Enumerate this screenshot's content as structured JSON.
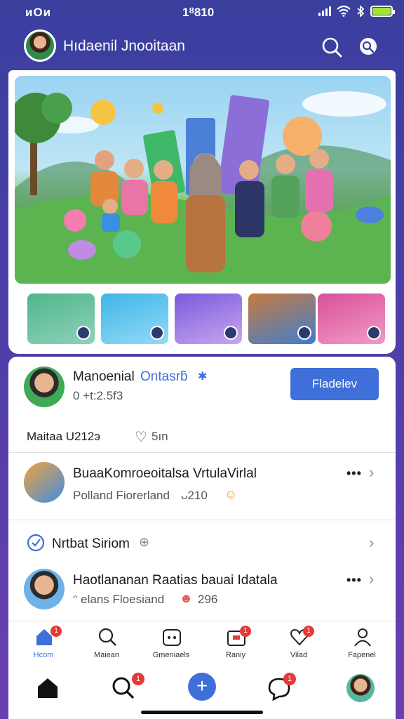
{
  "status": {
    "carrier": "ᴎOᴎ",
    "time": "1ᴽ810"
  },
  "header": {
    "title": "Hıdaenil Jnooitaan"
  },
  "creator": {
    "name": "Manoenial",
    "tag": "Ontasrƃ",
    "stats": "0 +t:2.5f3",
    "follow_label": "Fladelev"
  },
  "meta": {
    "left": "Maitaa U212э",
    "likes": "5ın"
  },
  "list": [
    {
      "title": "BuaaKomroeoitalsa VrtulaVirlal",
      "subtitle": "Polland Fiorerland",
      "count": "ᴗ210"
    },
    {
      "title": "Nrtbat Siriom"
    },
    {
      "title": "Haotlananan Raatias bauai Idatala",
      "subtitle": "ᵔ elans Floesiand",
      "count": "296"
    }
  ],
  "tabs": [
    {
      "label": "Hcom",
      "badge": "1",
      "icon": "home-icon"
    },
    {
      "label": "Maiean",
      "icon": "search-icon"
    },
    {
      "label": "Gmeniaels",
      "icon": "game-controller-icon"
    },
    {
      "label": "Raniy",
      "badge": "1",
      "icon": "inbox-icon"
    },
    {
      "label": "Vilad",
      "badge": "1",
      "icon": "heart-icon"
    },
    {
      "label": "Fapenel",
      "icon": "profile-icon"
    }
  ],
  "nav": {
    "search_badge": "1",
    "chat_badge": "1"
  },
  "colors": {
    "accent": "#3f6fd9",
    "header": "#3a3f9e",
    "badge": "#e53935"
  }
}
